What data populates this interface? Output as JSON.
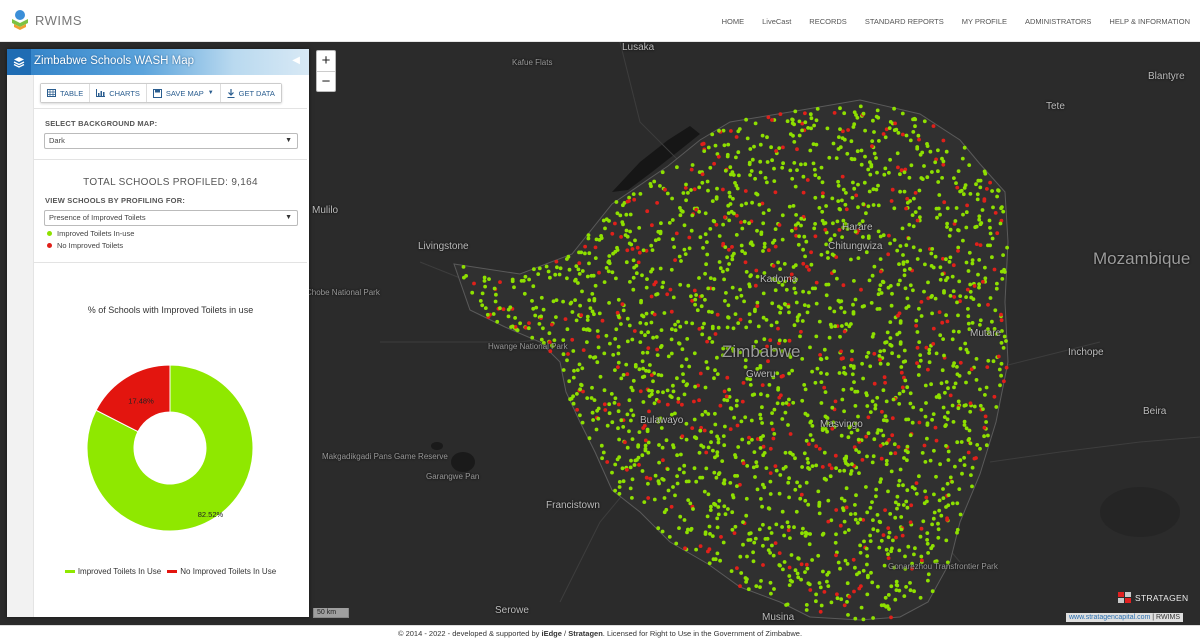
{
  "brand": {
    "name": "RWIMS"
  },
  "nav": {
    "items": [
      "HOME",
      "LiveCast",
      "RECORDS",
      "STANDARD REPORTS",
      "MY PROFILE",
      "ADMINISTRATORS",
      "HELP & INFORMATION"
    ]
  },
  "panel": {
    "title": "Zimbabwe Schools WASH Map",
    "toolbar": {
      "table": "TABLE",
      "charts": "CHARTS",
      "save_map": "SAVE MAP",
      "get_data": "GET DATA"
    },
    "background_map_label": "SELECT BACKGROUND MAP:",
    "background_map_value": "Dark",
    "total_schools": "TOTAL SCHOOLS PROFILED: 9,164",
    "profiling_label": "VIEW SCHOOLS BY PROFILING FOR:",
    "profiling_value": "Presence of Improved Toilets",
    "legend": [
      {
        "label": "Improved Toilets In-use",
        "color": "#8ee000"
      },
      {
        "label": "No Improved Toilets",
        "color": "#e0201a"
      }
    ]
  },
  "chart_data": {
    "type": "pie",
    "title": "% of Schools with Improved Toilets in use",
    "series": [
      {
        "name": "Improved Toilets In Use",
        "value": 82.52,
        "label": "82.52%",
        "color": "#8fe800"
      },
      {
        "name": "No Improved Toilets In Use",
        "value": 17.48,
        "label": "17.48%",
        "color": "#e3150f"
      }
    ],
    "legend_position": "bottom"
  },
  "map": {
    "zoom_in": "+",
    "zoom_out": "−",
    "scale_label": "50 km",
    "logo_text": "STRATAGEN",
    "attribution_link": "www.stratagencapital.com",
    "attribution_sep": " | RWIMS",
    "places": [
      "Lusaka",
      "Kafue Flats",
      "Blantyre",
      "Tete",
      "Mulilo",
      "Livingstone",
      "Harare",
      "Chitungwiza",
      "Kadoma",
      "Mozambique",
      "Chobe National Park",
      "Hwange National Park",
      "Mutare",
      "Inchope",
      "Zimbabwe",
      "Gweru",
      "Beira",
      "Bulawayo",
      "Masvingo",
      "Makgadikgadi Pans Game Reserve",
      "Garangwe Pan",
      "Francistown",
      "Gonarezhou Transfrontier Park",
      "Serowe",
      "Musina"
    ],
    "colors": {
      "background": "#2b2b2b",
      "improved": "#8ee000",
      "none": "#e0201a"
    }
  },
  "footer": {
    "text_before": "© 2014 - 2022 - developed & supported by ",
    "iedge": "iEdge",
    "slash": " / ",
    "stratagen": "Stratagen",
    "text_after": ". Licensed for Right to Use in the Government of Zimbabwe."
  }
}
